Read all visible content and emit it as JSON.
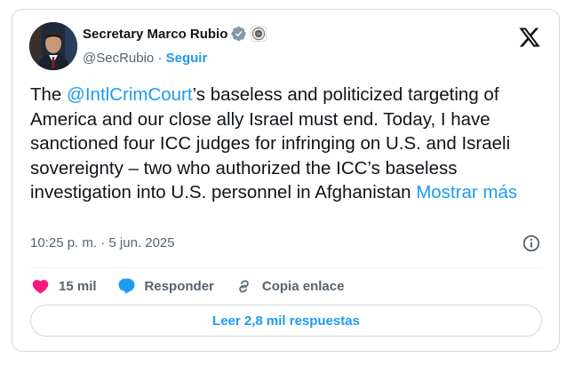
{
  "author": {
    "name": "Secretary Marco Rubio",
    "handle": "@SecRubio",
    "separator": "·",
    "follow_label": "Seguir"
  },
  "tweet": {
    "text_before": "The ",
    "mention": "@IntlCrimCourt",
    "text_after": "’s baseless and politicized targeting of America and our close ally Israel must end. Today, I have sanctioned four ICC judges for infringing on U.S. and Israeli sovereignty – two who authorized the ICC’s baseless investigation into U.S. personnel in Afghanistan ",
    "show_more": "Mostrar más"
  },
  "meta": {
    "time": "10:25 p. m.",
    "separator": " · ",
    "date": "5 jun. 2025"
  },
  "actions": {
    "likes_count": "15 mil",
    "reply_label": "Responder",
    "copy_label": "Copia enlace"
  },
  "read_replies_label": "Leer 2,8 mil respuestas",
  "colors": {
    "accent": "#1d9bf0",
    "like": "#f91880",
    "verified": "#829aab",
    "text": "#0f1419",
    "secondary": "#536471"
  },
  "icons": [
    "verified-badge-icon",
    "state-department-seal-icon",
    "x-logo-icon",
    "info-icon",
    "heart-icon",
    "reply-bubble-icon",
    "link-icon"
  ]
}
